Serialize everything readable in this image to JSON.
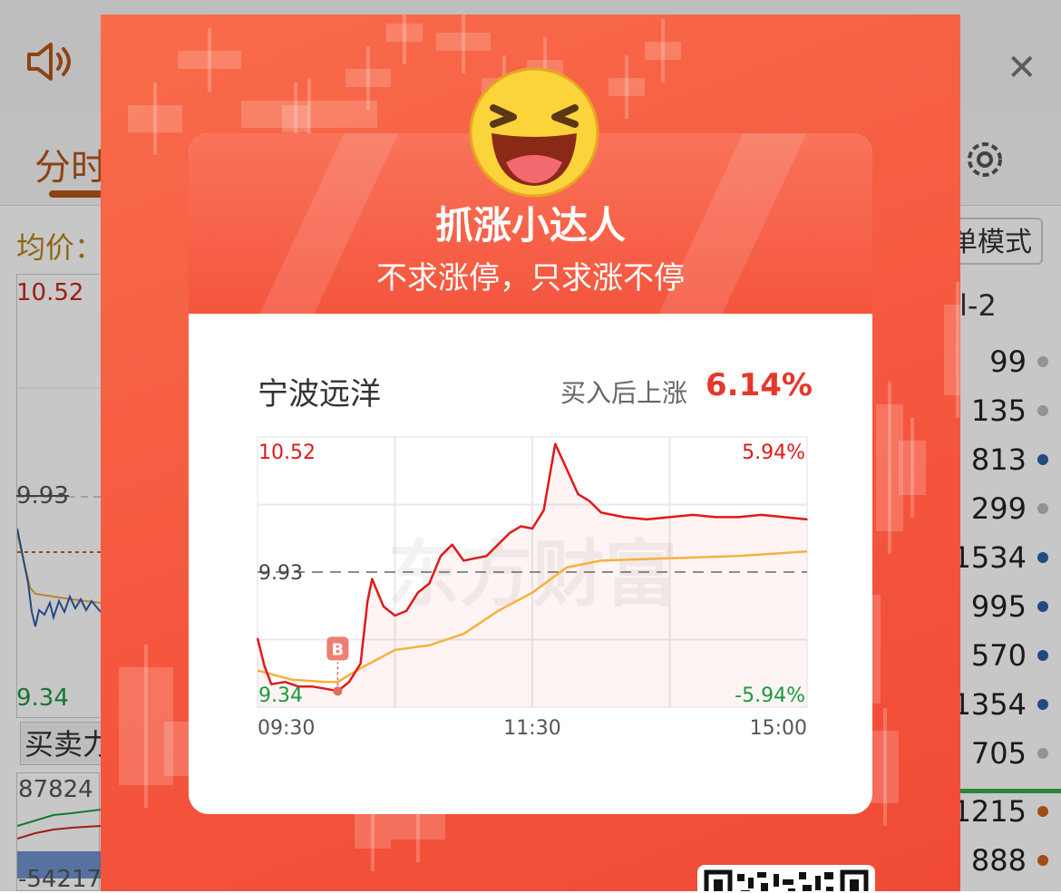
{
  "background": {
    "tab_fenshi": "分时",
    "avg_price_label": "均价：",
    "mode_button": "单模式",
    "chart": {
      "high": "10.52",
      "prev_close": "9.93",
      "low": "9.34"
    },
    "buy_sell_button": "买卖力",
    "vol_top": "87824",
    "vol_bottom": "-54217",
    "level_label": "l-2",
    "right_list": [
      {
        "value": "99",
        "dot": "#bdbdbd"
      },
      {
        "value": "135",
        "dot": "#bdbdbd"
      },
      {
        "value": "813",
        "dot": "#2b5fa8"
      },
      {
        "value": "299",
        "dot": "#bdbdbd"
      },
      {
        "value": "1534",
        "dot": "#2b5fa8"
      },
      {
        "value": "995",
        "dot": "#2b5fa8"
      },
      {
        "value": "570",
        "dot": "#2b5fa8"
      },
      {
        "value": "1354",
        "dot": "#2b5fa8"
      },
      {
        "value": "705",
        "dot": "#bdbdbd"
      },
      {
        "value": "1215",
        "dot": "#d2621b"
      },
      {
        "value": "888",
        "dot": "#d2621b"
      }
    ]
  },
  "popup": {
    "title": "抓涨小达人",
    "subtitle": "不求涨停，只求涨不停",
    "stock_name": "宁波远洋",
    "gain_label": "买入后上涨",
    "gain_value": "6.14%",
    "buy_marker": "B",
    "watermark": "东方财富",
    "colors": {
      "accent": "#e7362a",
      "avg_line": "#f5b13d",
      "price_line": "#e0191b"
    }
  },
  "chart_data": {
    "type": "line",
    "title": "",
    "x_ticks": [
      "09:30",
      "11:30",
      "15:00"
    ],
    "y_left_ticks": [
      "10.52",
      "9.93",
      "9.34"
    ],
    "y_right_ticks": [
      "5.94%",
      "-5.94%"
    ],
    "ylim": [
      9.34,
      10.52
    ],
    "prev_close": 9.93,
    "buy_point": {
      "x": "10:05",
      "y": 9.41
    },
    "series": [
      {
        "key": "price",
        "x": [
          "09:30",
          "09:33",
          "09:36",
          "09:42",
          "09:48",
          "09:54",
          "10:00",
          "10:05",
          "10:10",
          "10:15",
          "10:18",
          "10:20",
          "10:25",
          "10:30",
          "10:35",
          "10:40",
          "10:45",
          "10:50",
          "10:55",
          "11:00",
          "11:05",
          "11:10",
          "11:15",
          "11:20",
          "11:25",
          "11:30",
          "13:05",
          "13:10",
          "13:15",
          "13:20",
          "13:25",
          "13:30",
          "13:40",
          "13:50",
          "14:00",
          "14:10",
          "14:20",
          "14:30",
          "14:40",
          "14:50",
          "15:00"
        ],
        "values": [
          9.64,
          9.52,
          9.44,
          9.45,
          9.43,
          9.43,
          9.42,
          9.41,
          9.45,
          9.53,
          9.8,
          9.9,
          9.78,
          9.74,
          9.76,
          9.84,
          9.88,
          10.0,
          10.05,
          9.98,
          9.99,
          10.0,
          10.05,
          10.1,
          10.13,
          10.12,
          10.2,
          10.49,
          10.38,
          10.27,
          10.24,
          10.19,
          10.17,
          10.16,
          10.17,
          10.18,
          10.17,
          10.17,
          10.18,
          10.17,
          10.16
        ],
        "color": "#e0191b"
      },
      {
        "key": "average",
        "x": [
          "09:30",
          "09:45",
          "10:00",
          "10:05",
          "10:15",
          "10:30",
          "10:45",
          "11:00",
          "11:15",
          "11:30",
          "13:15",
          "13:30",
          "14:00",
          "14:30",
          "15:00"
        ],
        "values": [
          9.5,
          9.46,
          9.45,
          9.45,
          9.51,
          9.59,
          9.61,
          9.66,
          9.76,
          9.84,
          9.95,
          9.98,
          9.99,
          10.0,
          10.02
        ],
        "color": "#f5b13d"
      }
    ]
  }
}
